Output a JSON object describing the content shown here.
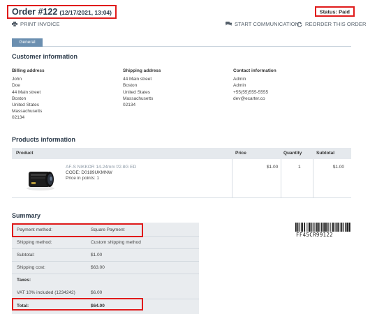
{
  "header": {
    "order_number": "Order #122",
    "order_date": "(12/17/2021, 13:04)",
    "status": "Status: Paid"
  },
  "actions": {
    "print_invoice": "PRINT INVOICE",
    "start_communication": "START COMMUNICATION",
    "reorder": "REORDER THIS ORDER"
  },
  "tabs": [
    "General"
  ],
  "customer": {
    "title": "Customer information",
    "billing": {
      "heading": "Billing address",
      "lines": [
        "John",
        "Doe",
        "44 Main street",
        "Boston",
        "United States",
        "Massachusetts",
        "02134"
      ]
    },
    "shipping": {
      "heading": "Shipping address",
      "lines": [
        "44 Main street",
        "Boston",
        "United States",
        "Massachusetts",
        "02134"
      ]
    },
    "contact": {
      "heading": "Contact information",
      "lines": [
        "Admin",
        "Admin",
        "+55(55)555-5555",
        "dev@ecarter.co"
      ]
    }
  },
  "products": {
    "title": "Products information",
    "columns": [
      "Product",
      "Price",
      "Quantity",
      "Subtotal"
    ],
    "items": [
      {
        "name": "AF-S NIKKOR 14-24mm f/2.8G ED",
        "code": "CODE: D0189UKMNW",
        "points": "Price in points:   1",
        "price": "$1.00",
        "quantity": "1",
        "subtotal": "$1.00"
      }
    ]
  },
  "summary": {
    "title": "Summary",
    "payment_label": "Payment method:",
    "payment_value": "Square Payment",
    "shipping_method_label": "Shipping method:",
    "shipping_method_value": "Custom shipping method",
    "subtotal_label": "Subtotal:",
    "subtotal_value": "$1.00",
    "shipping_cost_label": "Shipping cost:",
    "shipping_cost_value": "$63.00",
    "taxes_label": "Taxes:",
    "vat_label": "VAT 10% included (1234242)",
    "vat_value": "$6.00",
    "total_label": "Total:",
    "total_value": "$64.00"
  },
  "barcode": {
    "text": "FF45CR99122"
  },
  "colors": {
    "highlight_border": "#e01b1b",
    "tab_active": "#6b8fb0",
    "table_header_bg": "#e5e9ed",
    "summary_bg": "#e9ecef"
  }
}
